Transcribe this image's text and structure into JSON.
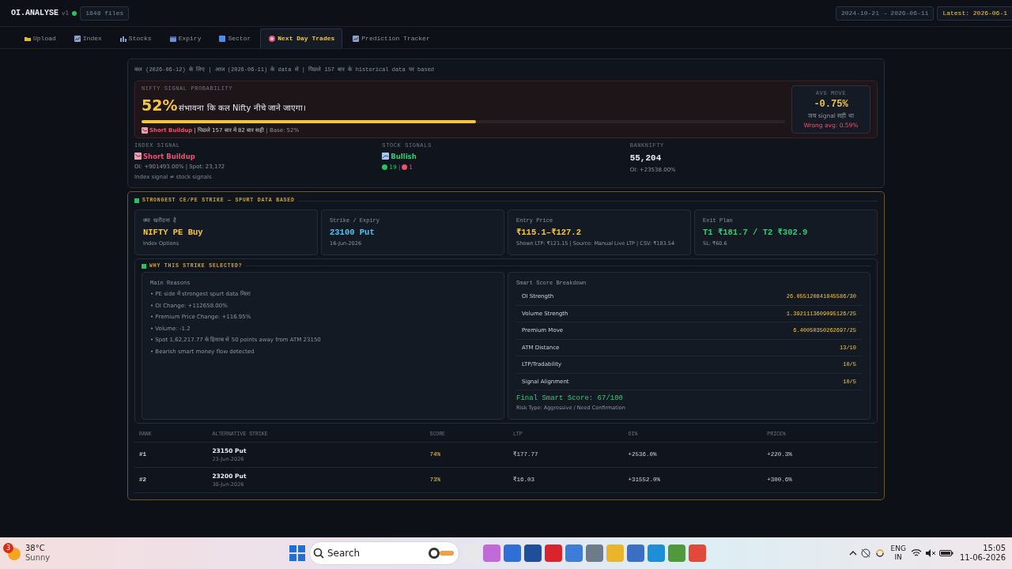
{
  "header": {
    "logo": "OI.ANALYSE",
    "version": "v1",
    "files": "1848 files",
    "date_range": "2024-10-21 → 2026-06-11",
    "latest": "Latest: 2026-06-1"
  },
  "tabs": [
    {
      "label": "Upload",
      "kind": "folder",
      "selected": false
    },
    {
      "label": "Index",
      "kind": "chart",
      "selected": false
    },
    {
      "label": "Stocks",
      "kind": "bars",
      "selected": false
    },
    {
      "label": "Expiry",
      "kind": "calendar",
      "selected": false
    },
    {
      "label": "Sector",
      "kind": "square",
      "selected": false
    },
    {
      "label": "Next Day Trades",
      "kind": "target",
      "selected": true
    },
    {
      "label": "Prediction Tracker",
      "kind": "chart",
      "selected": false
    }
  ],
  "forecast": {
    "caption": "कल (2026-06-12) के लिए | आज (2026-06-11) के data से | पिछले 157 बार के historical data पर based",
    "probability": {
      "label": "NIFTY SIGNAL PROBABILITY",
      "percent": "52%",
      "text": "संभावना कि कल Nifty नीचे जाने जाएगा।",
      "level": 0.52,
      "buildup": "Short Buildup",
      "history": "| पिछले 157 बार में 82 बार सही",
      "base": "| Base: 52%"
    },
    "avg_move": {
      "label": "AVG MOVE",
      "value": "-0.75%",
      "note": "जब signal सही था",
      "wrong": "Wrong avg: 0.59%"
    },
    "signals": [
      {
        "kind": "index",
        "label": "INDEX SIGNAL",
        "value": "Short Buildup",
        "color": "#f0506e",
        "detail": "OI: +901493.00% | Spot: 23,172",
        "note": "Index signal ≠ stock signals"
      },
      {
        "kind": "stocks",
        "label": "STOCK SIGNALS",
        "value": "Bullish",
        "color": "#2ecc71",
        "separator": "|",
        "counts": [
          {
            "color": "#22c55e",
            "value": "19"
          },
          {
            "color": "#f0506e",
            "value": "1"
          }
        ]
      },
      {
        "kind": "bank",
        "label": "BANKNIFTY",
        "value": "55,204",
        "color": "#e6edf3",
        "detail": "OI: +23538.00%"
      }
    ]
  },
  "strike": {
    "title": "STRONGEST CE/PE STRIKE — SPURT DATA BASED",
    "cards": [
      {
        "label": "क्या खरीदना है",
        "value": "NIFTY PE Buy",
        "color": "#f5c542",
        "sub": "Index Options"
      },
      {
        "label": "Strike / Expiry",
        "value": "23100 Put",
        "color": "#4fc3f7",
        "sub": "16-Jun-2026"
      },
      {
        "label": "Entry Price",
        "value": "₹115.1–₹127.2",
        "color": "#f5c542",
        "sub": "Shown LTP: ₹121.15 | Source: Manual Live LTP | CSV: ₹183.54"
      },
      {
        "label": "Exit Plan",
        "value": "T1 ₹181.7 / T2 ₹302.9",
        "color": "#2ecc71",
        "sub": "SL: ₹60.6"
      }
    ],
    "why": {
      "title": "WHY THIS STRIKE SELECTED?",
      "reasons_title": "Main Reasons",
      "reasons": [
        "• PE side में strongest spurt data मिला",
        "• OI Change: +112658.00%",
        "• Premium Price Change: +116.95%",
        "• Volume: -1.2",
        "• Spot 1,62,217.77 के हिसाब से 50 points away from ATM 23150",
        "• Bearish smart money flow detected"
      ],
      "score_title": "Smart Score Breakdown",
      "scores": [
        {
          "label": "OI Strength",
          "value": "26.055120841845586/30"
        },
        {
          "label": "Volume Strength",
          "value": "1.3921113609095126/25"
        },
        {
          "label": "Premium Move",
          "value": "6.40050350262697/25"
        },
        {
          "label": "ATM Distance",
          "value": "13/10"
        },
        {
          "label": "LTP/Tradability",
          "value": "10/5"
        },
        {
          "label": "Signal Alignment",
          "value": "10/5"
        }
      ],
      "final": "Final Smart Score: 67/100",
      "risk": "Risk Type: Aggressive / Need Confirmation"
    },
    "table": {
      "columns": [
        "RANK",
        "ALTERNATIVE STRIKE",
        "SCORE",
        "LTP",
        "OI%",
        "PRICE%"
      ],
      "rows": [
        {
          "rank": "#1",
          "strike": "23150 Put",
          "expiry": "23-Jun-2026",
          "score": "74%",
          "ltp": "₹177.77",
          "oi": "+2536.0%",
          "price": "+220.3%"
        },
        {
          "rank": "#2",
          "strike": "23200 Put",
          "expiry": "30-Jun-2026",
          "score": "73%",
          "ltp": "₹16.03",
          "oi": "+31552.0%",
          "price": "+300.6%"
        }
      ]
    }
  },
  "taskbar": {
    "weather": {
      "badge": "3",
      "temp": "38°C",
      "condition": "Sunny"
    },
    "search": "Search",
    "language": [
      "ENG",
      "IN"
    ],
    "time": "15:05",
    "date": "11-06-2026"
  }
}
